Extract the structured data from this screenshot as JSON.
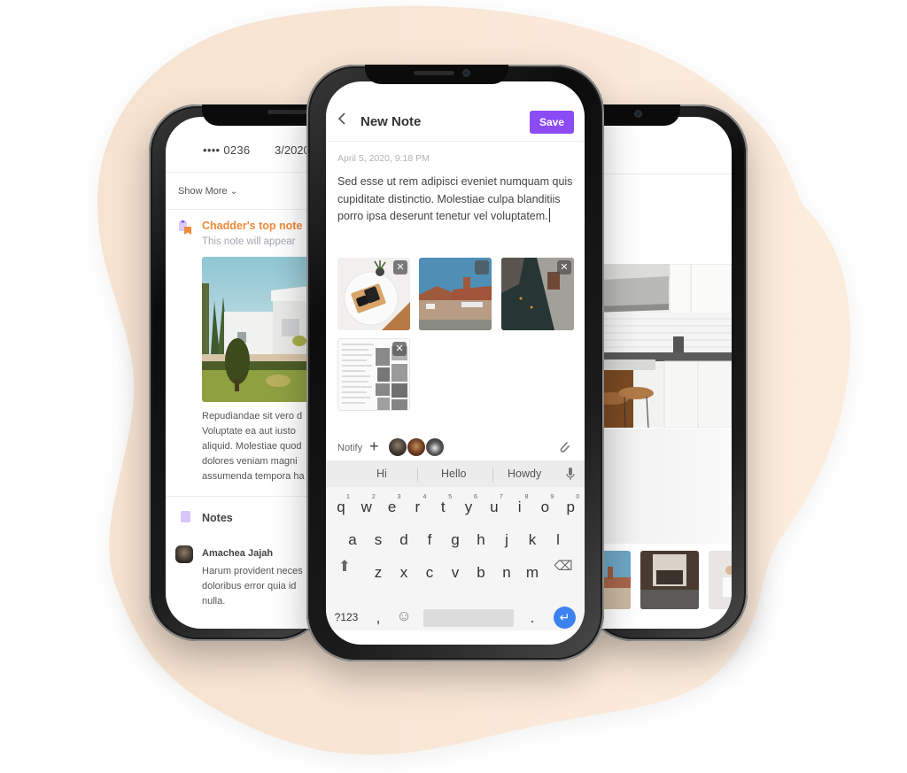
{
  "colors": {
    "accent": "#8b4cf6",
    "highlight": "#f08a3a",
    "blob": "#fbe9d7",
    "enter": "#3c82f0"
  },
  "center_phone": {
    "header": {
      "back_icon": "chevron-left-icon",
      "title": "New Note",
      "save_label": "Save"
    },
    "date": "April 5, 2020, 9:18 PM",
    "body_text": "Sed esse ut rem adipisci eveniet numquam quis cupiditate distinctio. Molestiae culpa blanditiis porro ipsa deserunt tenetur vel voluptatem.",
    "attachments": [
      {
        "subject": "desk with tablet and plant",
        "remove_icon": "close-icon"
      },
      {
        "subject": "brick houses",
        "remove_icon": "close-icon"
      },
      {
        "subject": "narrow alley",
        "remove_icon": "close-icon"
      },
      {
        "subject": "document page",
        "remove_icon": "close-icon"
      }
    ],
    "remove_glyph": "✕",
    "notify": {
      "label": "Notify",
      "add_glyph": "+",
      "avatars": [
        "person-1",
        "person-2",
        "person-3"
      ],
      "attach_icon": "paperclip-icon"
    },
    "keyboard": {
      "suggestions": [
        "Hi",
        "Hello",
        "Howdy"
      ],
      "row1": [
        "q",
        "w",
        "e",
        "r",
        "t",
        "y",
        "u",
        "i",
        "o",
        "p"
      ],
      "row1_nums": [
        "1",
        "2",
        "3",
        "4",
        "5",
        "6",
        "7",
        "8",
        "9",
        "0"
      ],
      "row2": [
        "a",
        "s",
        "d",
        "f",
        "g",
        "h",
        "j",
        "k",
        "l"
      ],
      "row3": [
        "z",
        "x",
        "c",
        "v",
        "b",
        "n",
        "m"
      ],
      "symbols_label": "?123",
      "comma": ",",
      "period": ".",
      "emoji_glyph": "☺",
      "shift_glyph": "⬆",
      "backspace_glyph": "⌫",
      "enter_glyph": "↵"
    }
  },
  "left_phone": {
    "card_number": "•••• 0236",
    "card_date": "3/2020",
    "show_more": "Show More",
    "show_more_chevron": "⌄",
    "top_note": {
      "title": "Chadder's top note",
      "subtitle": "This note will appear"
    },
    "paragraph": [
      "Repudiandae sit vero d",
      "Voluptate ea aut iusto",
      "aliquid. Molestiae quod",
      "dolores veniam magni",
      "assumenda tempora ha"
    ],
    "notes_title": "Notes",
    "comment": {
      "author": "Amachea Jajah",
      "lines": [
        "Harum provident neces",
        "doloribus error quia id",
        "nulla."
      ]
    }
  },
  "right_phone": {
    "hero_subject": "white kitchen with stools",
    "thumbnails": [
      "brick houses",
      "window interior",
      "white mug"
    ]
  }
}
